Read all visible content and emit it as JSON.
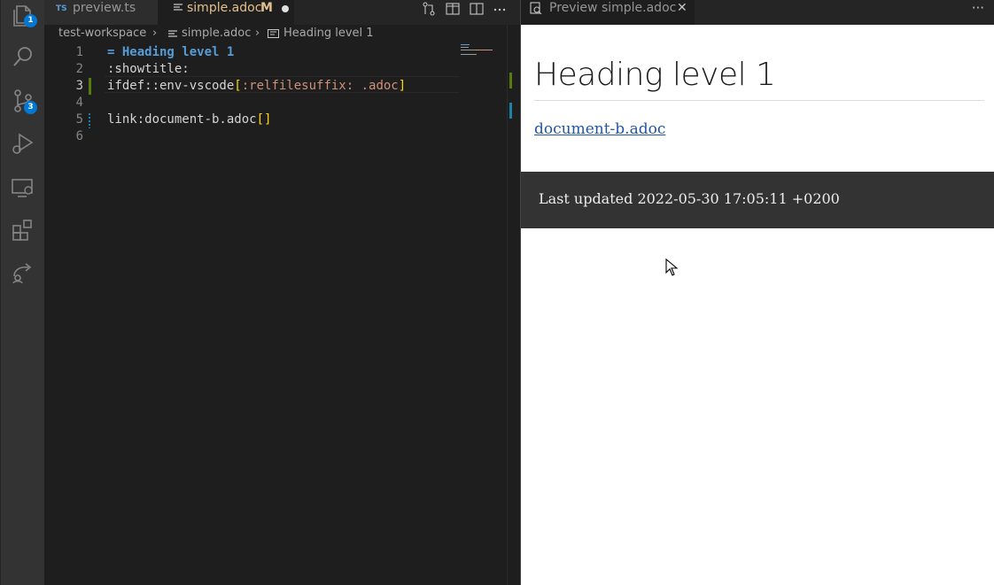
{
  "activitybar": {
    "explorer_badge": "1",
    "scm_badge": "3"
  },
  "tabs": [
    {
      "icon_text": "TS",
      "label": "preview.ts"
    },
    {
      "label": "simple.adoc",
      "status": "M"
    }
  ],
  "breadcrumb": {
    "workspace": "test-workspace",
    "file": "simple.adoc",
    "symbol": "Heading level 1"
  },
  "editor": {
    "lines": [
      {
        "number": "1",
        "parts": [
          {
            "cls": "c-heading",
            "text": "= Heading level 1"
          }
        ]
      },
      {
        "number": "2",
        "parts": [
          {
            "cls": "",
            "text": ":showtitle:"
          }
        ]
      },
      {
        "number": "3",
        "parts": [
          {
            "cls": "",
            "text": "ifdef::env-vscode"
          },
          {
            "cls": "c-bracket",
            "text": "["
          },
          {
            "cls": "c-attr",
            "text": ":relfilesuffix: .adoc"
          },
          {
            "cls": "c-bracket",
            "text": "]"
          }
        ]
      },
      {
        "number": "4",
        "parts": []
      },
      {
        "number": "5",
        "parts": [
          {
            "cls": "",
            "text": "link:document-b.adoc"
          },
          {
            "cls": "c-bracket",
            "text": "[]"
          }
        ]
      },
      {
        "number": "6",
        "parts": []
      }
    ]
  },
  "preview": {
    "tab_label": "Preview simple.adoc",
    "heading": "Heading level 1",
    "link": "document-b.adoc",
    "footer": "Last updated 2022-05-30 17:05:11 +0200"
  }
}
